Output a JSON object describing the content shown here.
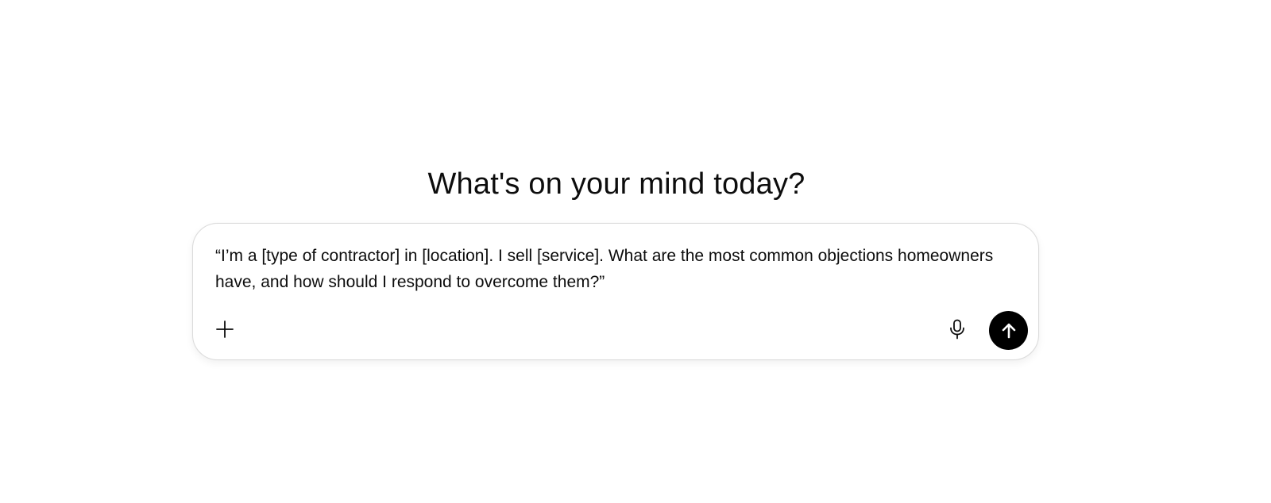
{
  "main": {
    "headline": "What's on your mind today?"
  },
  "composer": {
    "prompt_text": "“I’m a [type of contractor] in [location]. I sell [service]. What are the most common objections homeowners have, and how should I respond to overcome them?”",
    "attach_icon": "plus-icon",
    "voice_icon": "microphone-icon",
    "send_icon": "arrow-up-icon"
  },
  "colors": {
    "send_button_bg": "#000000",
    "text": "#0d0d0d",
    "composer_border": "#dcdcdc"
  }
}
